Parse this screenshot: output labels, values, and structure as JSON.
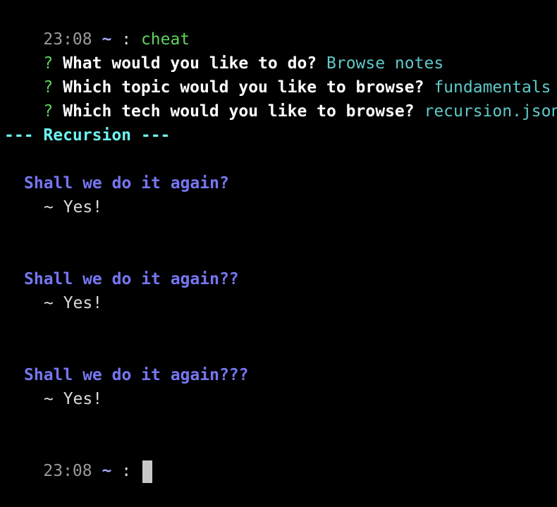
{
  "prompt1": {
    "time": "23:08",
    "tilde": "~",
    "colon": ":",
    "command": "cheat"
  },
  "questions": [
    {
      "mark": "?",
      "question": "What would you like to do?",
      "answer": "Browse notes"
    },
    {
      "mark": "?",
      "question": "Which topic would you like to browse?",
      "answer": "fundamentals"
    },
    {
      "mark": "?",
      "question": "Which tech would you like to browse?",
      "answer": "recursion.json"
    }
  ],
  "section_header": "--- Recursion ---",
  "notes": [
    {
      "question": "Shall we do it again?",
      "answer": "~ Yes!"
    },
    {
      "question": "Shall we do it again??",
      "answer": "~ Yes!"
    },
    {
      "question": "Shall we do it again???",
      "answer": "~ Yes!"
    }
  ],
  "prompt2": {
    "time": "23:08",
    "tilde": "~",
    "colon": ":"
  },
  "colors": {
    "background": "#000000",
    "prompt_time": "#8a8a8a",
    "command": "#5fd35f",
    "question_mark": "#5fd35f",
    "answer": "#5fc9c9",
    "section_header": "#6ef1f1",
    "note_question": "#7676f2"
  }
}
